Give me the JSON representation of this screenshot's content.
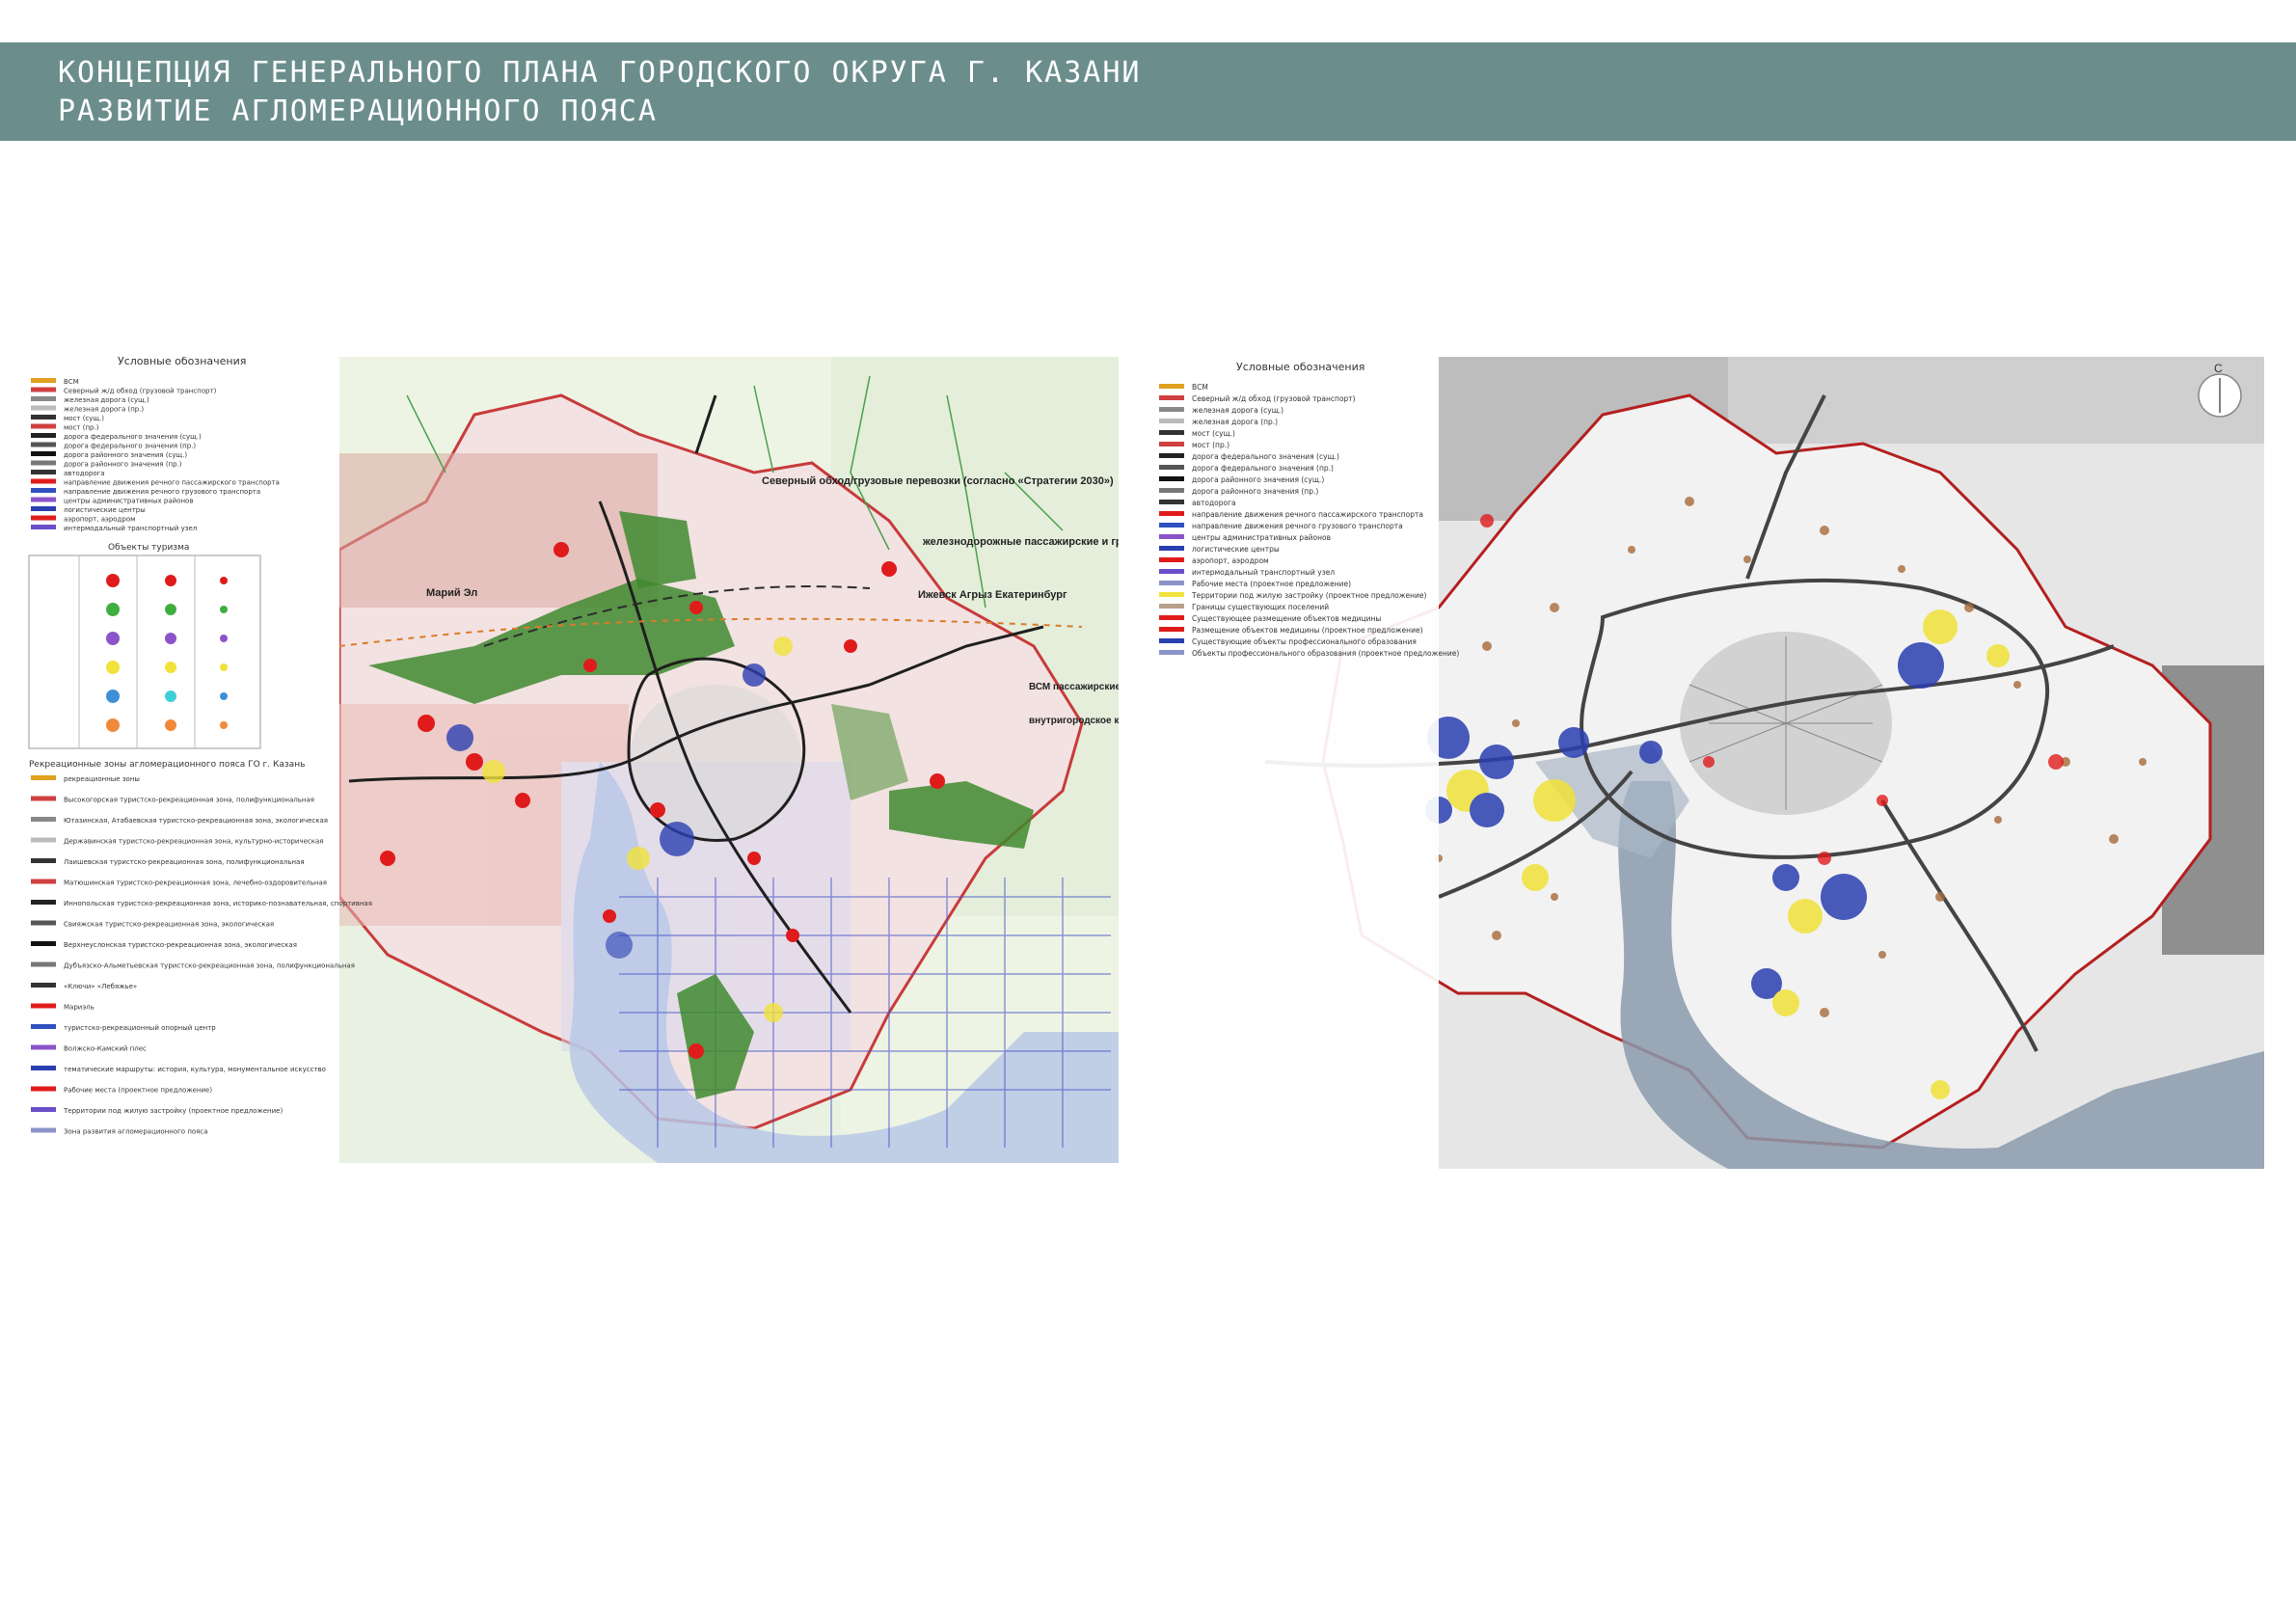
{
  "header": {
    "line1": "КОНЦЕПЦИЯ ГЕНЕРАЛЬНОГО ПЛАНА ГОРОДСКОГО ОКРУГА Г. КАЗАНИ",
    "line2": "РАЗВИТИЕ АГЛОМЕРАЦИОННОГО ПОЯСА",
    "background_color": "#6b8e8c",
    "text_color": "#ffffff"
  },
  "left_map": {
    "legend_title": "Условные обозначения",
    "legend_items": [
      "ВСМ",
      "Северный ж/д обход (грузовой транспорт)",
      "железная дорога (сущ.)",
      "железная дорога (пр.)",
      "мост (сущ.)",
      "мост (пр.)",
      "дорога федерального значения (сущ.)",
      "дорога федерального значения (пр.)",
      "дорога районного значения (сущ.)",
      "дорога районного значения (пр.)",
      "автодорога",
      "направление движения речного пассажирского транспорта",
      "направление движения речного грузового транспорта",
      "центры административных районов",
      "логистические центры",
      "аэропорт, аэродром",
      "интермодальный транспортный узел"
    ],
    "table_title": "Объекты туризма",
    "zones_title": "Рекреационные зоны агломерационного пояса ГО г. Казань",
    "zones": [
      "рекреационные зоны",
      "Высокогорская туристско-рекреационная зона, полифункциональная",
      "Ютазинская, Атабаевская туристско-рекреационная зона, экологическая",
      "Державинская туристско-рекреационная зона, культурно-историческая",
      "Лаишевская туристско-рекреационная зона, полифункциональная",
      "Матюшинская туристско-рекреационная зона, лечебно-оздоровительная",
      "Иннопольская туристско-рекреационная зона, историко-познавательная, спортивная",
      "Свияжская туристско-рекреационная зона, экологическая",
      "Верхнеуслонская туристско-рекреационная зона, экологическая",
      "Дубъязско-Альметьевская туристско-рекреационная зона, полифункциональная",
      "«Ключи» «Лебяжье»",
      "Мариэль",
      "туристско-рекреационный опорный центр",
      "Волжско-Камский плес",
      "тематические маршруты: история, культура, монументальное искусство",
      "Рабочие места (проектное предложение)",
      "Территории под жилую застройку (проектное предложение)",
      "Зона развития агломерационного пояса"
    ],
    "place_labels": [
      "Марий Эл",
      "Северный обход/грузовые перевозки (согласно «Стратегии 2030»)",
      "железнодорожные пассажирские и грузовые перевозки",
      "Ижевск Агрыз Екатеринбург",
      "ВСМ пассажирские и грузовые перевозки",
      "внутригородское кольцо электротранспорта"
    ]
  },
  "right_map": {
    "legend_title": "Условные обозначения",
    "legend_items": [
      "ВСМ",
      "Северный ж/д обход (грузовой транспорт)",
      "железная дорога (сущ.)",
      "железная дорога (пр.)",
      "мост (сущ.)",
      "мост (пр.)",
      "дорога федерального значения (сущ.)",
      "дорога федерального значения (пр.)",
      "дорога районного значения (сущ.)",
      "дорога районного значения (пр.)",
      "автодорога",
      "направление движения речного пассажирского транспорта",
      "направление движения речного грузового транспорта",
      "центры административных районов",
      "логистические центры",
      "аэропорт, аэродром",
      "интермодальный транспортный узел",
      "Рабочие места (проектное предложение)",
      "Территории под жилую застройку (проектное предложение)",
      "Границы существующих поселений",
      "Существующее размещение объектов медицины",
      "Размещение объектов медицины (проектное предложение)",
      "Существующие объекты профессионального образования",
      "Объекты профессионального образования (проектное предложение)"
    ],
    "compass": "С"
  }
}
